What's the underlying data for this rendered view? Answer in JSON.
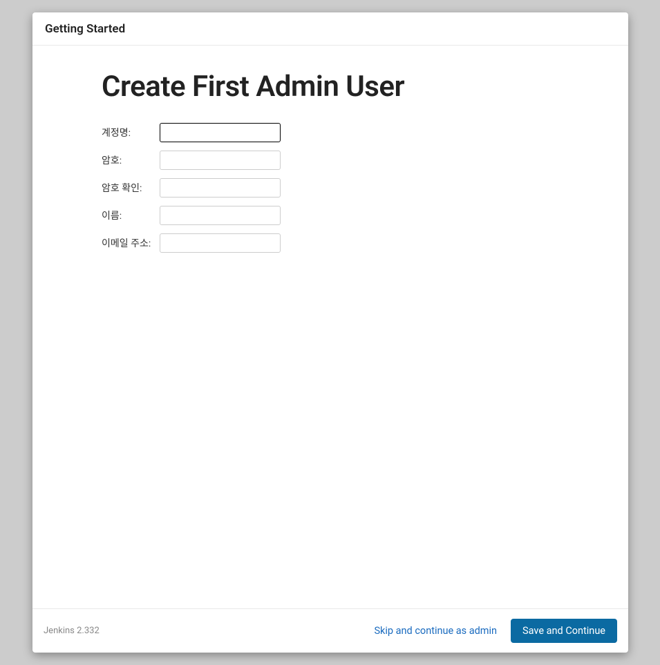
{
  "header": {
    "title": "Getting Started"
  },
  "main": {
    "heading": "Create First Admin User",
    "fields": {
      "username": {
        "label": "계정명:",
        "value": ""
      },
      "password": {
        "label": "암호:",
        "value": ""
      },
      "confirm": {
        "label": "암호 확인:",
        "value": ""
      },
      "fullname": {
        "label": "이름:",
        "value": ""
      },
      "email": {
        "label": "이메일 주소:",
        "value": ""
      }
    }
  },
  "footer": {
    "version": "Jenkins 2.332",
    "skip_label": "Skip and continue as admin",
    "save_label": "Save and Continue"
  }
}
